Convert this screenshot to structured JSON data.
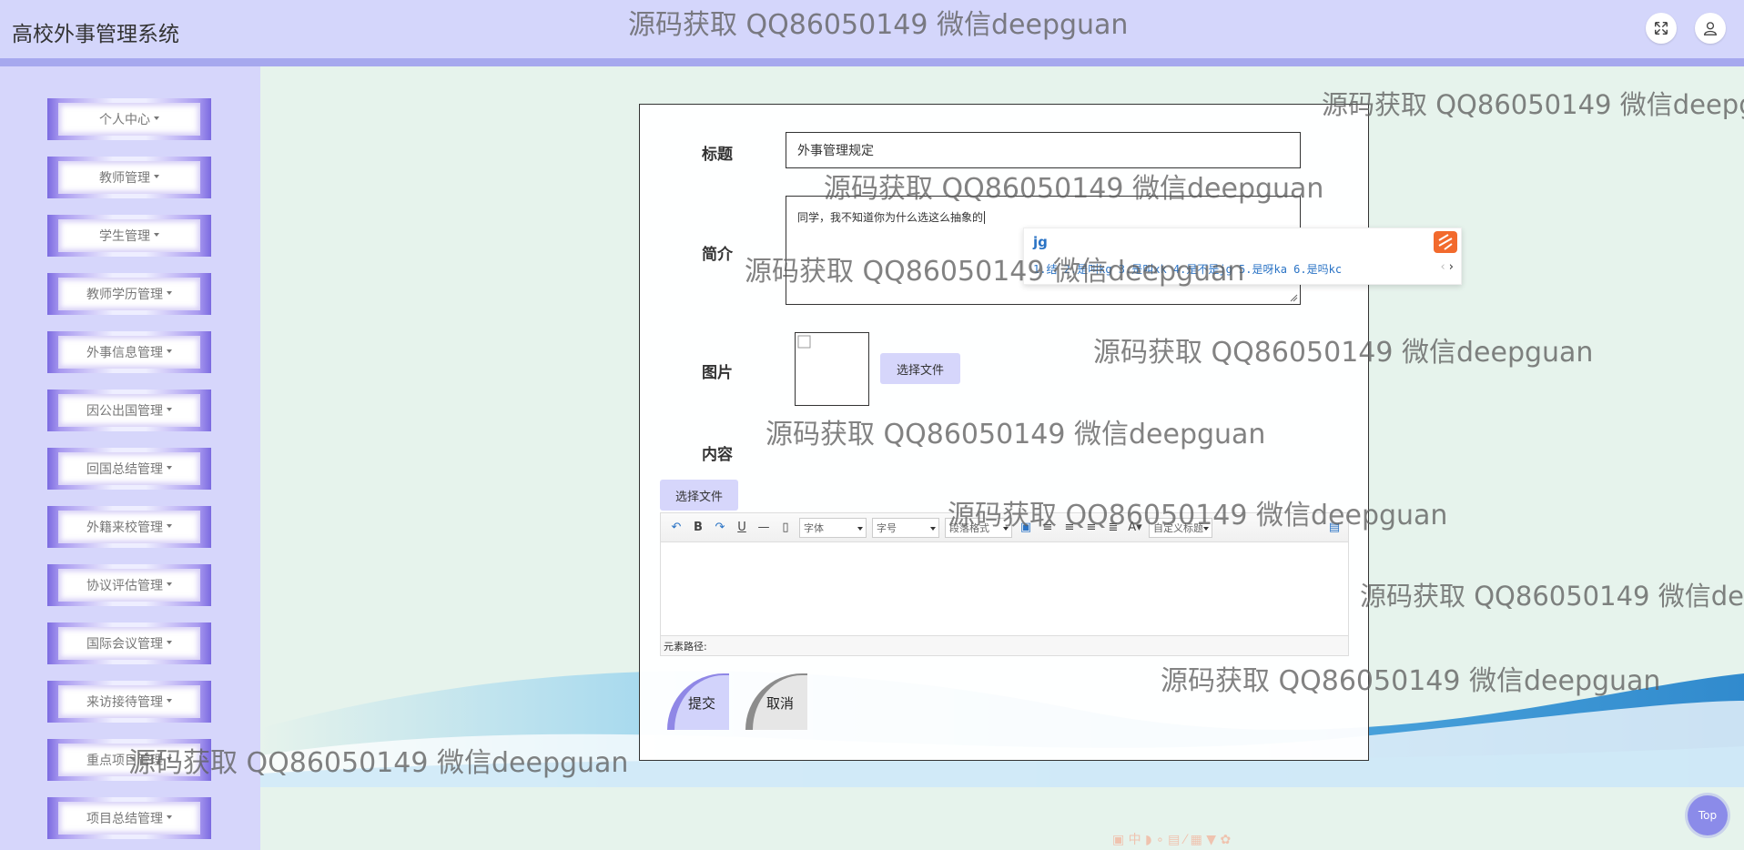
{
  "app": {
    "title": "高校外事管理系统"
  },
  "header": {
    "fullscreen_icon": "fullscreen-icon",
    "user_icon": "user-icon"
  },
  "sidebar": {
    "items": [
      {
        "label": "个人中心"
      },
      {
        "label": "教师管理"
      },
      {
        "label": "学生管理"
      },
      {
        "label": "教师学历管理"
      },
      {
        "label": "外事信息管理"
      },
      {
        "label": "因公出国管理"
      },
      {
        "label": "回国总结管理"
      },
      {
        "label": "外籍来校管理"
      },
      {
        "label": "协议评估管理"
      },
      {
        "label": "国际会议管理"
      },
      {
        "label": "来访接待管理"
      },
      {
        "label": "重点项目管理"
      },
      {
        "label": "项目总结管理"
      }
    ]
  },
  "form": {
    "title_label": "标题",
    "title_value": "外事管理规定",
    "summary_label": "简介",
    "summary_value": "同学，我不知道你为什么选这么抽象的",
    "image_label": "图片",
    "choose_file": "选择文件",
    "content_label": "内容",
    "content_choose_file": "选择文件",
    "submit": "提交",
    "cancel": "取消"
  },
  "editor": {
    "font_select": "字体",
    "size_select": "字号",
    "paragraph_select": "段落格式",
    "custom_title_select": "自定义标题",
    "status_path": "元素路径:"
  },
  "ime": {
    "input": "jg",
    "candidates": "1.结 2.是叫kg 3.是叫xk 4.是不是jg 5.是呀ka 6.是吗kc"
  },
  "watermark": {
    "text": "源码获取 QQ86050149 微信deepguan"
  },
  "top_button": "Top",
  "colors": {
    "header_bg": "#d4d6fb",
    "sidebar_bg": "#d6d6fb",
    "accent": "#7b6ae0",
    "top_button": "#8b8be9"
  }
}
